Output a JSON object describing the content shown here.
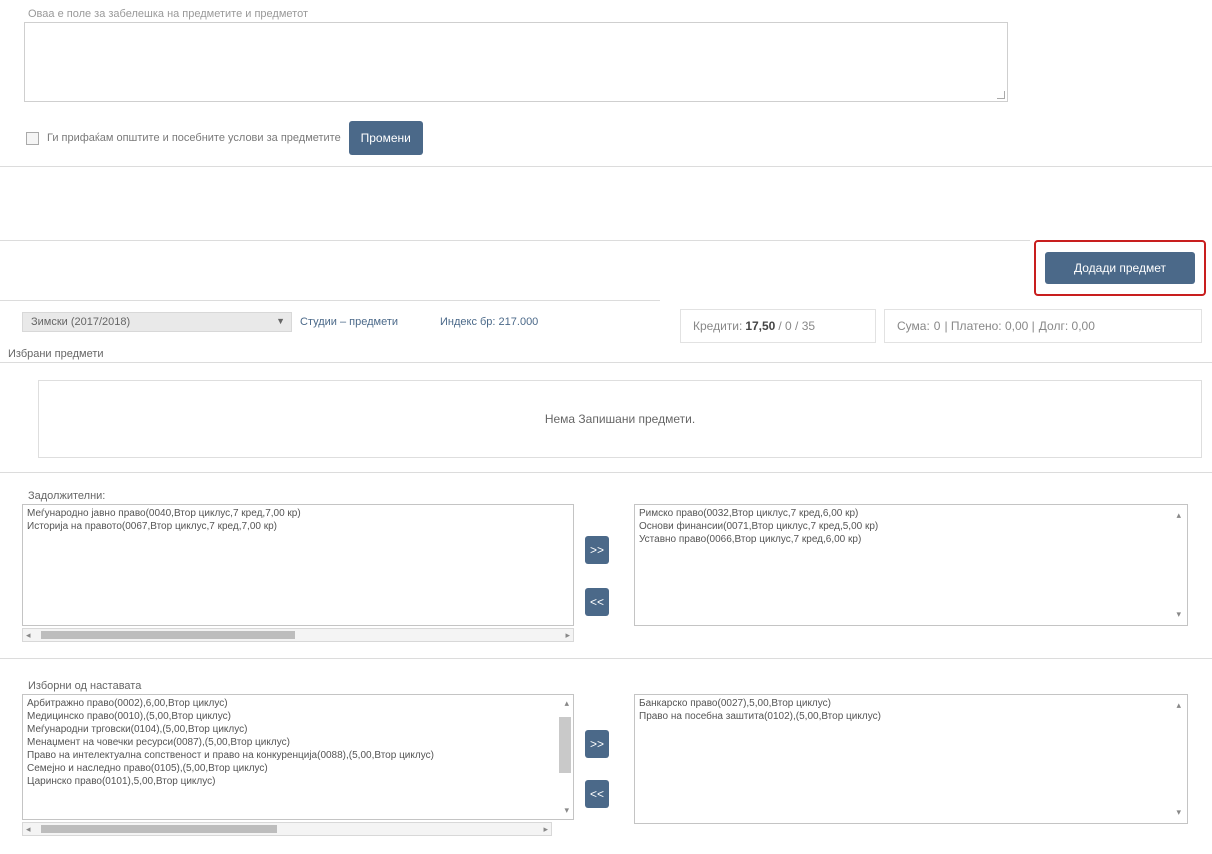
{
  "notes": {
    "label": "Оваа е поле за забелешка на предметите и предметот",
    "checkbox_label": "Ги прифаќам општите и посебните услови за предметите",
    "change_button": "Промени"
  },
  "add_subject_button": "Додади предмет",
  "semester_select": "Зимски (2017/2018)",
  "studies_link": "Студии – предмети",
  "index_number": "Индекс бр: 217.000",
  "credits": {
    "label": "Кредити:",
    "value": "17,50",
    "rest": "/ 0 / 35"
  },
  "payment": {
    "sum_label": "Сума:",
    "sum": "0",
    "paid_label": "| Платено: 0,00 |",
    "debt_label": "Долг: 0,00"
  },
  "selected_subjects": {
    "label": "Избрани предмети",
    "empty": "Нема Запишани предмети."
  },
  "mandatory": {
    "label": "Задолжителни:",
    "left_items": [
      "Меѓународно јавно право(0040,Втор циклус,7 кред,7,00 кр)",
      "Историја на правото(0067,Втор циклус,7 кред,7,00 кр)"
    ],
    "right_items": [
      "Римско право(0032,Втор циклус,7 кред,6,00 кр)",
      "Основи финансии(0071,Втор циклус,7 кред,5,00 кр)",
      "Уставно право(0066,Втор циклус,7 кред,6,00 кр)"
    ]
  },
  "electives": {
    "label": "Изборни од наставата",
    "left_items": [
      "Арбитражно право(0002),6,00,Втор циклус)",
      "Медицинско право(0010),(5,00,Втор циклус)",
      "Меѓународни трговски(0104),(5,00,Втор циклус)",
      "Менаџмент на човечки ресурси(0087),(5,00,Втор циклус)",
      "Право на интелектуална сопственост и право на конкуренција(0088),(5,00,Втор циклус)",
      "Семејно и наследно право(0105),(5,00,Втор циклус)",
      "Царинско право(0101),5,00,Втор циклус)"
    ],
    "right_items": [
      "Банкарско право(0027),5,00,Втор циклус)",
      "Право на посебна заштита(0102),(5,00,Втор циклус)"
    ]
  },
  "move_right": ">>",
  "move_left": "<<",
  "colors": {
    "button": "#4b6989",
    "highlight_border": "#c81e1e"
  }
}
